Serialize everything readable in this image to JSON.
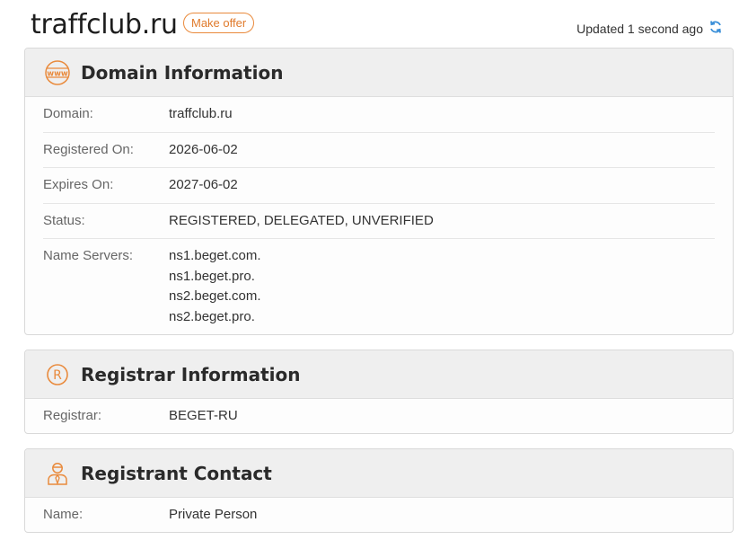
{
  "header": {
    "domain": "traffclub.ru",
    "offer_label": "Make offer",
    "updated_text": "Updated 1 second ago"
  },
  "domain_info": {
    "title": "Domain Information",
    "icon": "www-icon",
    "rows": [
      {
        "label": "Domain:",
        "value": "traffclub.ru"
      },
      {
        "label": "Registered On:",
        "value": "2026-06-02"
      },
      {
        "label": "Expires On:",
        "value": "2027-06-02"
      },
      {
        "label": "Status:",
        "value": "REGISTERED, DELEGATED, UNVERIFIED"
      }
    ],
    "name_servers_label": "Name Servers:",
    "name_servers": [
      "ns1.beget.com.",
      "ns1.beget.pro.",
      "ns2.beget.com.",
      "ns2.beget.pro."
    ]
  },
  "registrar_info": {
    "title": "Registrar Information",
    "icon": "registered-icon",
    "rows": [
      {
        "label": "Registrar:",
        "value": "BEGET-RU"
      }
    ]
  },
  "registrant_contact": {
    "title": "Registrant Contact",
    "icon": "person-icon",
    "rows": [
      {
        "label": "Name:",
        "value": "Private Person"
      }
    ]
  },
  "colors": {
    "accent": "#e98a3c",
    "refresh": "#3a8fd8"
  }
}
